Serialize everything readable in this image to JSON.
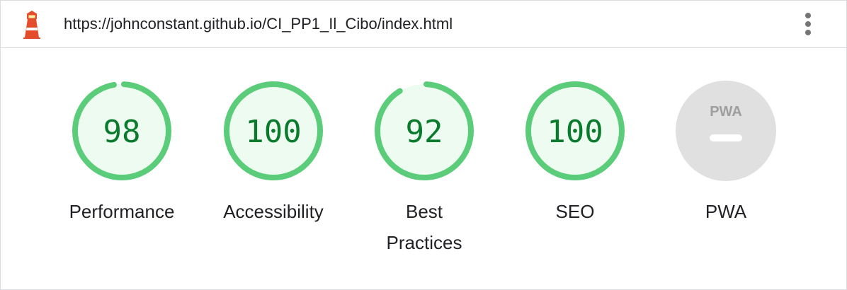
{
  "header": {
    "url": "https://johnconstant.github.io/CI_PP1_Il_Cibo/index.html",
    "logo_icon": "lighthouse-icon",
    "menu_icon": "kebab-menu-icon"
  },
  "colors": {
    "pass_ring": "#5bcc79",
    "pass_fill": "#eefbf1",
    "pass_text": "#0a7a2c",
    "pwa_fill": "#e0e0e0",
    "lighthouse_red": "#e44d2b"
  },
  "gauges": [
    {
      "label": "Performance",
      "score": "98",
      "value": 98
    },
    {
      "label": "Accessibility",
      "score": "100",
      "value": 100
    },
    {
      "label": "Best Practices",
      "score": "92",
      "value": 92
    },
    {
      "label": "SEO",
      "score": "100",
      "value": 100
    },
    {
      "label": "PWA",
      "badge": "PWA",
      "icon": "pwa-badge-icon"
    }
  ]
}
